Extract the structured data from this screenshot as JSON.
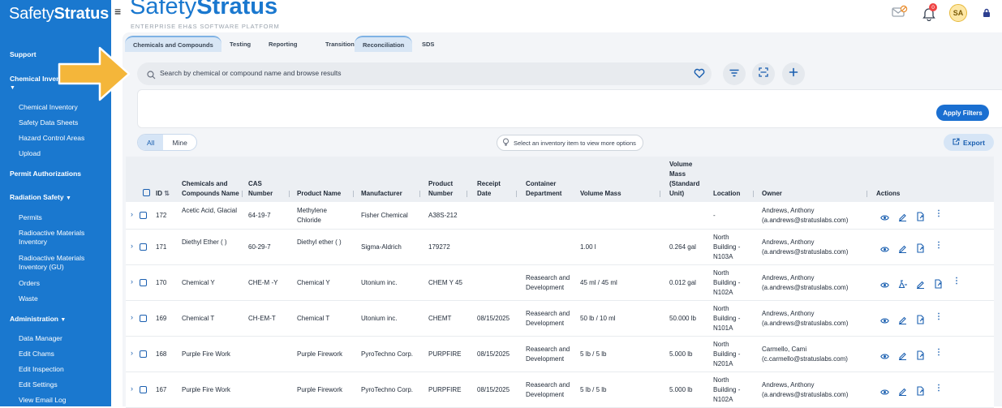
{
  "sidebar": {
    "logo_a": "Safety",
    "logo_b": "Stratus",
    "support": "Support",
    "chem_inv_section": "Chemical Inventory",
    "chem_items": [
      "Chemical Inventory",
      "Safety Data Sheets",
      "Hazard Control Areas",
      "Upload"
    ],
    "permit_auth": "Permit Authorizations",
    "radiation": "Radiation Safety",
    "rad_items": [
      "Permits",
      "Radioactive Materials Inventory",
      "Radioactive Materials Inventory (GU)",
      "Orders",
      "Waste"
    ],
    "administration": "Administration",
    "admin_items": [
      "Data Manager",
      "Edit Chams",
      "Edit Inspection",
      "Edit Settings",
      "View Email Log"
    ]
  },
  "header": {
    "brand_a": "Safety",
    "brand_b": "Stratus",
    "tagline": "ENTERPRISE EH&S SOFTWARE PLATFORM",
    "notif_count": "0",
    "avatar": "SA"
  },
  "tabs": [
    "Chemicals and Compounds",
    "Testing",
    "Reporting",
    "Transitions",
    "Reconciliation",
    "SDS"
  ],
  "search": {
    "placeholder": "Search by chemical or compound name and browse results"
  },
  "apply_filters": "Apply Filters",
  "segment": {
    "all": "All",
    "mine": "Mine"
  },
  "hint": "Select an inventory item to view more options",
  "export": "Export",
  "columns": {
    "id": "ID",
    "name": "Chemicals and Compounds Name",
    "cas": "CAS Number",
    "product_name": "Product Name",
    "manufacturer": "Manufacturer",
    "product_number": "Product Number",
    "receipt_date": "Receipt Date",
    "container_dept": "Container Department",
    "volume_mass": "Volume Mass",
    "volume_std": "Volume Mass (Standard Unit)",
    "location": "Location",
    "owner": "Owner",
    "actions": "Actions"
  },
  "rows": [
    {
      "id": "172",
      "name": "Acetic Acid, Glacial",
      "cas": "64-19-7",
      "product_name": "Methylene Chloride",
      "manufacturer": "Fisher Chemical",
      "product_number": "A38S-212",
      "receipt_date": "",
      "dept": "",
      "vm": "",
      "vms": "",
      "location": "-",
      "owner": "Andrews, Anthony",
      "email": "(a.andrews@stratuslabs.com)"
    },
    {
      "id": "171",
      "name": "Diethyl Ether ( )",
      "cas": "60-29-7",
      "product_name": "Diethyl ether ( )",
      "manufacturer": "Sigma-Aldrich",
      "product_number": "179272",
      "receipt_date": "",
      "dept": "",
      "vm": "1.00 l",
      "vms": "0.264 gal",
      "location": "North Building - N103A",
      "owner": "Andrews, Anthony",
      "email": "(a.andrews@stratuslabs.com)"
    },
    {
      "id": "170",
      "name": "Chemical Y",
      "cas": "CHE-M -Y",
      "product_name": "Chemical Y",
      "manufacturer": "Utonium inc.",
      "product_number": "CHEM Y 45",
      "receipt_date": "",
      "dept": "Reasearch and Development",
      "vm": "45 ml / 45 ml",
      "vms": "0.012 gal",
      "location": "North Building - N102A",
      "owner": "Andrews, Anthony",
      "email": "(a.andrews@stratuslabs.com)"
    },
    {
      "id": "169",
      "name": "Chemical T",
      "cas": "CH-EM-T",
      "product_name": "Chemical T",
      "manufacturer": "Utonium inc.",
      "product_number": "CHEMT",
      "receipt_date": "08/15/2025",
      "dept": "Reasearch and Development",
      "vm": "50 lb / 10 ml",
      "vms": "50.000 lb",
      "location": "North Building - N101A",
      "owner": "Andrews, Anthony",
      "email": "(a.andrews@stratuslabs.com)"
    },
    {
      "id": "168",
      "name": "Purple Fire Work",
      "cas": "",
      "product_name": "Purple Firework",
      "manufacturer": "PyroTechno Corp.",
      "product_number": "PURPFIRE",
      "receipt_date": "08/15/2025",
      "dept": "Reasearch and Development",
      "vm": "5 lb / 5 lb",
      "vms": "5.000 lb",
      "location": "North Building - N201A",
      "owner": "Carmello, Cami",
      "email": "(c.carmello@stratuslabs.com)"
    },
    {
      "id": "167",
      "name": "Purple Fire Work",
      "cas": "",
      "product_name": "Purple Firework",
      "manufacturer": "PyroTechno Corp.",
      "product_number": "PURPFIRE",
      "receipt_date": "08/15/2025",
      "dept": "Reasearch and Development",
      "vm": "5 lb / 5 lb",
      "vms": "5.000 lb",
      "location": "North Building - N102A",
      "owner": "Andrews, Anthony",
      "email": "(a.andrews@stratuslabs.com)"
    }
  ],
  "colors": {
    "brand": "#1a78cf",
    "arrow": "#f4b63a"
  }
}
